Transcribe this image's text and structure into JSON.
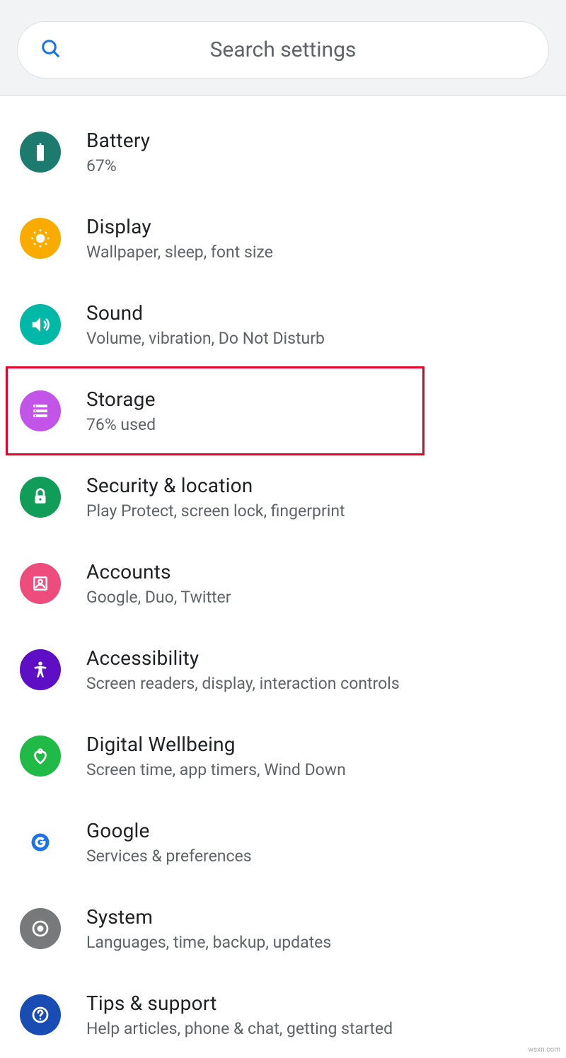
{
  "search": {
    "placeholder": "Search settings"
  },
  "items": [
    {
      "id": "battery",
      "title": "Battery",
      "subtitle": "67%",
      "color": "#1c7b6e",
      "highlighted": false
    },
    {
      "id": "display",
      "title": "Display",
      "subtitle": "Wallpaper, sleep, font size",
      "color": "#f9ab00",
      "highlighted": false
    },
    {
      "id": "sound",
      "title": "Sound",
      "subtitle": "Volume, vibration, Do Not Disturb",
      "color": "#00b8a6",
      "highlighted": false
    },
    {
      "id": "storage",
      "title": "Storage",
      "subtitle": "76% used",
      "color": "#c354e8",
      "highlighted": true
    },
    {
      "id": "security",
      "title": "Security & location",
      "subtitle": "Play Protect, screen lock, fingerprint",
      "color": "#0f9d58",
      "highlighted": false
    },
    {
      "id": "accounts",
      "title": "Accounts",
      "subtitle": "Google, Duo, Twitter",
      "color": "#ee4c7d",
      "highlighted": false
    },
    {
      "id": "accessibility",
      "title": "Accessibility",
      "subtitle": "Screen readers, display, interaction controls",
      "color": "#5e0fc6",
      "highlighted": false
    },
    {
      "id": "wellbeing",
      "title": "Digital Wellbeing",
      "subtitle": "Screen time, app timers, Wind Down",
      "color": "#20ba46",
      "highlighted": false
    },
    {
      "id": "google",
      "title": "Google",
      "subtitle": "Services & preferences",
      "color": "#ffffff",
      "highlighted": false
    },
    {
      "id": "system",
      "title": "System",
      "subtitle": "Languages, time, backup, updates",
      "color": "#78797a",
      "highlighted": false
    },
    {
      "id": "tips",
      "title": "Tips & support",
      "subtitle": "Help articles, phone & chat, getting started",
      "color": "#1a4db3",
      "highlighted": false
    }
  ],
  "watermark": "wsxn.com"
}
